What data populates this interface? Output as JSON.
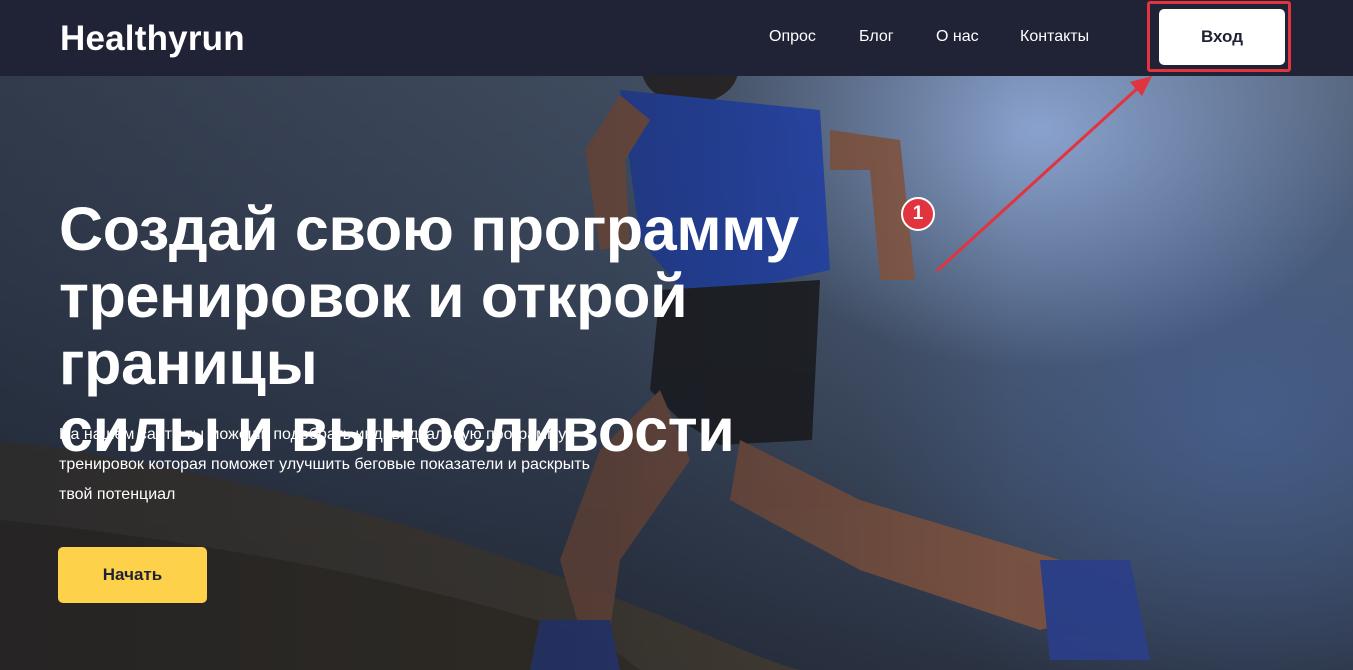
{
  "header": {
    "logo": "Healthyrun",
    "nav": [
      {
        "label": "Опрос"
      },
      {
        "label": "Блог"
      },
      {
        "label": "О нас"
      },
      {
        "label": "Контакты"
      }
    ],
    "login_label": "Вход"
  },
  "hero": {
    "title_lines": [
      "Создай свою программу",
      "тренировок и открой границы",
      "силы и выносливости"
    ],
    "description_lines": [
      "На нашем сайте ты можешь подобрать индивидуальную программу",
      "тренировок которая поможет улучшить беговые показатели и раскрыть",
      "твой потенциал"
    ],
    "start_label": "Начать"
  },
  "annotation": {
    "step_number": "1",
    "color": "#e2343f"
  },
  "colors": {
    "header_bg": "#202236",
    "accent_yellow": "#fdd24a",
    "text_dark": "#1f2233"
  }
}
